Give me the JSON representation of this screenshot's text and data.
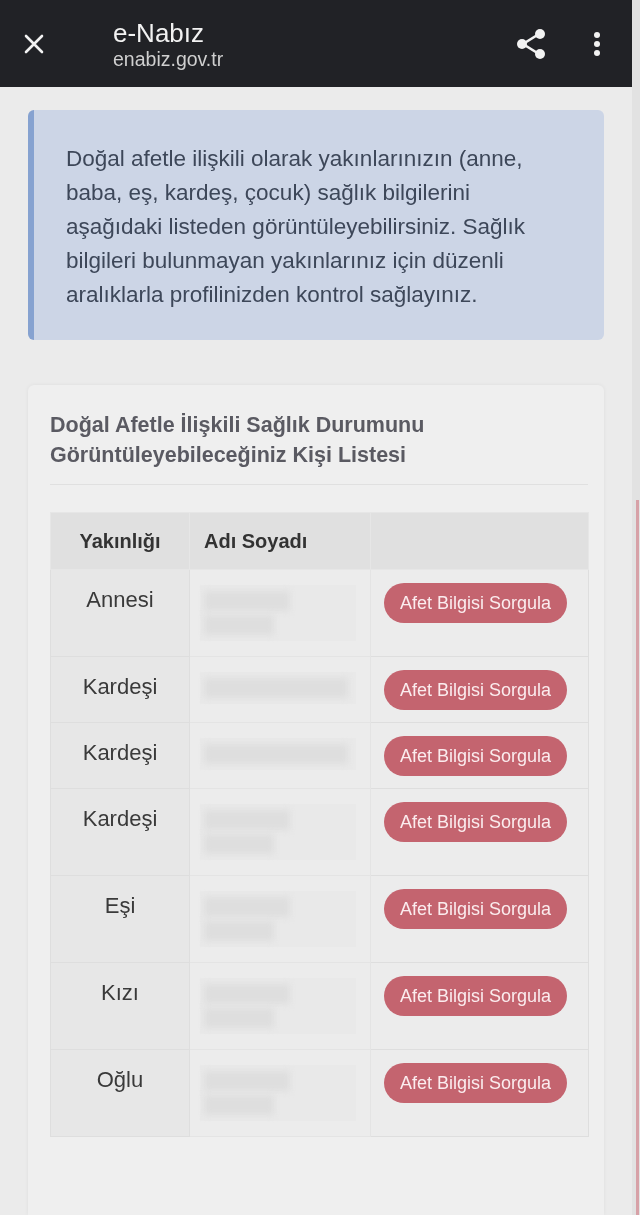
{
  "top_bar": {
    "title": "e-Nabız",
    "url": "enabiz.gov.tr"
  },
  "info_box": {
    "text": "Doğal afetle ilişkili olarak yakınlarınızın (anne, baba, eş, kardeş, çocuk) sağlık bilgilerini aşağıdaki listeden görüntüleyebilirsiniz. Sağlık bilgileri bulunmayan yakınlarınız için düzenli aralıklarla profilinizden kontrol sağlayınız."
  },
  "card": {
    "title": "Doğal Afetle İlişkili Sağlık Durumunu Görüntüleyebileceğiniz Kişi Listesi",
    "table": {
      "columns": [
        "Yakınlığı",
        "Adı Soyadı"
      ],
      "rows": [
        {
          "kind": "tall",
          "relation": "Annesi",
          "action": "Afet Bilgisi Sorgula"
        },
        {
          "kind": "short",
          "relation": "Kardeşi",
          "action": "Afet Bilgisi Sorgula"
        },
        {
          "kind": "short",
          "relation": "Kardeşi",
          "action": "Afet Bilgisi Sorgula"
        },
        {
          "kind": "tall",
          "relation": "Kardeşi",
          "action": "Afet Bilgisi Sorgula"
        },
        {
          "kind": "tall",
          "relation": "Eşi",
          "action": "Afet Bilgisi Sorgula"
        },
        {
          "kind": "tall",
          "relation": "Kızı",
          "action": "Afet Bilgisi Sorgula"
        },
        {
          "kind": "tall",
          "relation": "Oğlu",
          "action": "Afet Bilgisi Sorgula"
        }
      ]
    }
  }
}
